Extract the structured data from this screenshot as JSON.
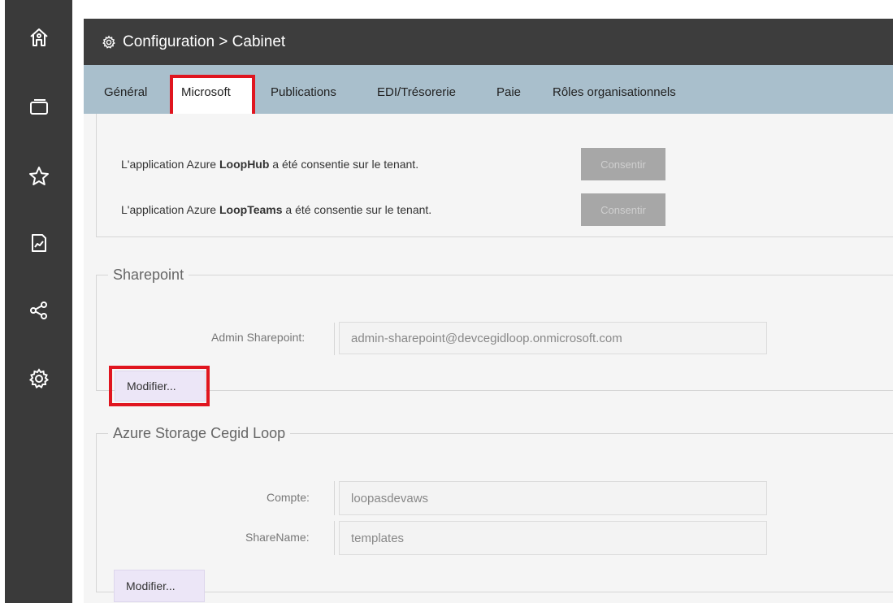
{
  "sidebar": {
    "items": [
      {
        "icon": "home-icon"
      },
      {
        "icon": "screens-icon"
      },
      {
        "icon": "star-icon"
      },
      {
        "icon": "report-icon"
      },
      {
        "icon": "share-icon"
      },
      {
        "icon": "settings-icon"
      }
    ]
  },
  "header": {
    "icon": "gear-icon",
    "title": "Configuration > Cabinet"
  },
  "tabs": [
    {
      "label": "Général"
    },
    {
      "label": "Microsoft",
      "active": true
    },
    {
      "label": "Publications"
    },
    {
      "label": "EDI/Trésorerie"
    },
    {
      "label": "Paie"
    },
    {
      "label": "Rôles organisationnels"
    }
  ],
  "consent": {
    "rows": [
      {
        "prefix": "L'application Azure ",
        "app": "LoopHub",
        "suffix": " a été consentie sur le tenant.",
        "button": "Consentir"
      },
      {
        "prefix": "L'application Azure ",
        "app": "LoopTeams",
        "suffix": " a été consentie sur le tenant.",
        "button": "Consentir"
      }
    ]
  },
  "sharepoint": {
    "legend": "Sharepoint",
    "admin_label": "Admin Sharepoint:",
    "admin_value": "admin-sharepoint@devcegidloop.onmicrosoft.com",
    "modify_label": "Modifier..."
  },
  "azure_storage": {
    "legend": "Azure Storage Cegid Loop",
    "account_label": "Compte:",
    "account_value": "loopasdevaws",
    "share_label": "ShareName:",
    "share_value": "templates",
    "modify_label": "Modifier..."
  },
  "colors": {
    "sidebar": "#3a3a3a",
    "titlebar": "#3d3d3d",
    "tabbar": "#a9bfcc",
    "highlight": "#e0151f",
    "button_disabled": "#a7a7a7",
    "button_modify": "#ece6f7"
  }
}
